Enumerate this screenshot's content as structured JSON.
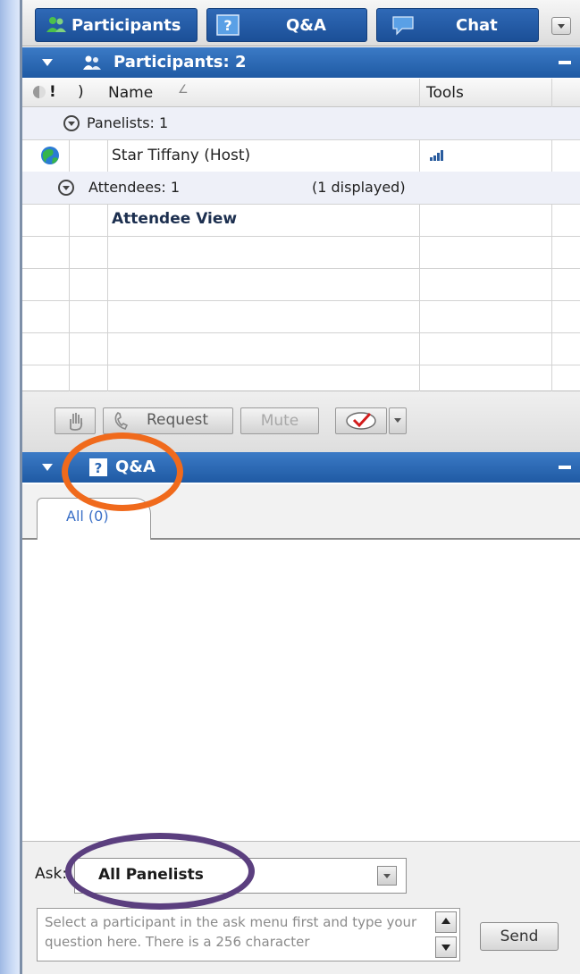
{
  "tabs": [
    {
      "label": "Participants",
      "icon": "people-icon"
    },
    {
      "label": "Q&A",
      "icon": "question-icon"
    },
    {
      "label": "Chat",
      "icon": "speech-bubble-icon"
    }
  ],
  "participants_panel": {
    "title": "Participants: 2",
    "columns": {
      "status": "!",
      "name": "Name",
      "tools": "Tools"
    },
    "panelists_group": "Panelists: 1",
    "panelist": {
      "name": "Star Tiffany (Host)"
    },
    "attendees_group": "Attendees: 1",
    "attendees_displayed": "(1 displayed)",
    "attendee_row": "Attendee View"
  },
  "toolbar": {
    "request_label": "Request",
    "mute_label": "Mute"
  },
  "qa_panel": {
    "title": "Q&A",
    "tab_all": "All (0)",
    "ask_label": "Ask:",
    "ask_selected": "All Panelists",
    "question_placeholder": "Select a participant in the ask menu first and type your question here. There is a 256 character",
    "send_label": "Send"
  },
  "colors": {
    "header_blue": "#2a66b3",
    "highlight_orange": "#f06a1c",
    "highlight_purple": "#5b3f7f"
  }
}
